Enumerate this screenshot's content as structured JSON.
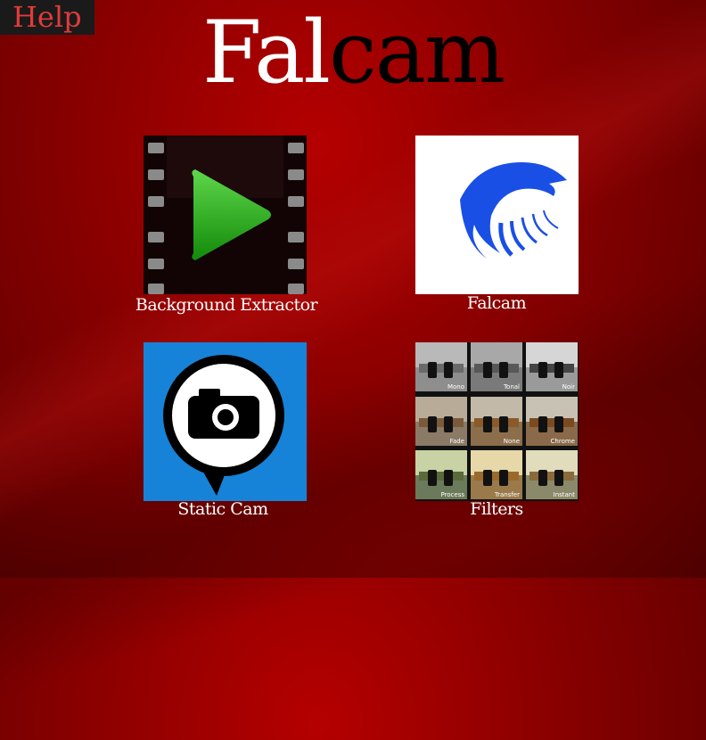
{
  "help": {
    "label": "Help"
  },
  "title": {
    "part1": "Fal",
    "part2": "cam"
  },
  "tiles": [
    {
      "label": "Background Extractor",
      "icon": "video-play-icon"
    },
    {
      "label": "Falcam",
      "icon": "falcon-logo-icon"
    },
    {
      "label": "Static Cam",
      "icon": "camera-chat-icon"
    },
    {
      "label": "Filters",
      "icon": "filters-grid-icon"
    }
  ],
  "filters": [
    "Mono",
    "Tonal",
    "Noir",
    "Fade",
    "None",
    "Chrome",
    "Process",
    "Transfer",
    "Instant"
  ],
  "colors": {
    "background": "#8c0000",
    "help_text": "#e23b3b",
    "help_bg": "#1a1a1a",
    "play_green": "#22a81a",
    "falcon_blue": "#1a4fe6",
    "static_blue": "#1683d8"
  }
}
